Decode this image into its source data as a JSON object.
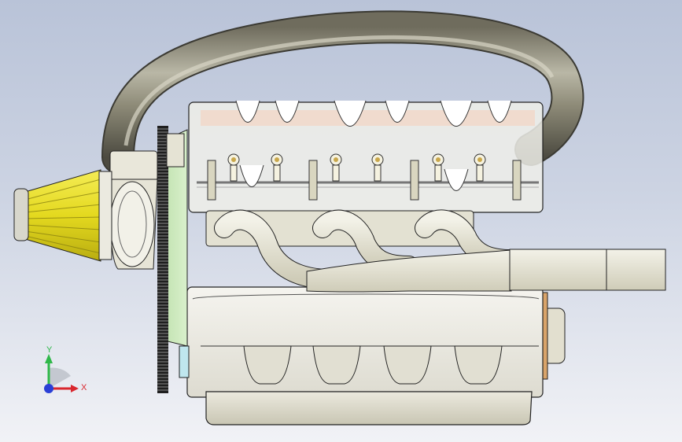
{
  "view": {
    "background_top": "#b9c3d8",
    "background_bottom": "#f1f2f6"
  },
  "model": {
    "parts": [
      "air-filter",
      "intake-pipe",
      "timing-belt-pulley",
      "cylinder-head",
      "valve-rockers",
      "exhaust-manifold",
      "engine-block",
      "oil-pan",
      "rear-flywheel-hub"
    ],
    "colors": {
      "air_filter": "#e7de2c",
      "pulley_plate": "#cde9bf",
      "pipe": "#8a8770",
      "exhaust": "#e6e4d4",
      "block": "#ecebe4",
      "outline": "#222222"
    }
  },
  "triad": {
    "y_label": "Y",
    "x_label": "X",
    "y_color": "#2fb84a",
    "x_color": "#d9272e",
    "z_color": "#2a3fd6"
  }
}
